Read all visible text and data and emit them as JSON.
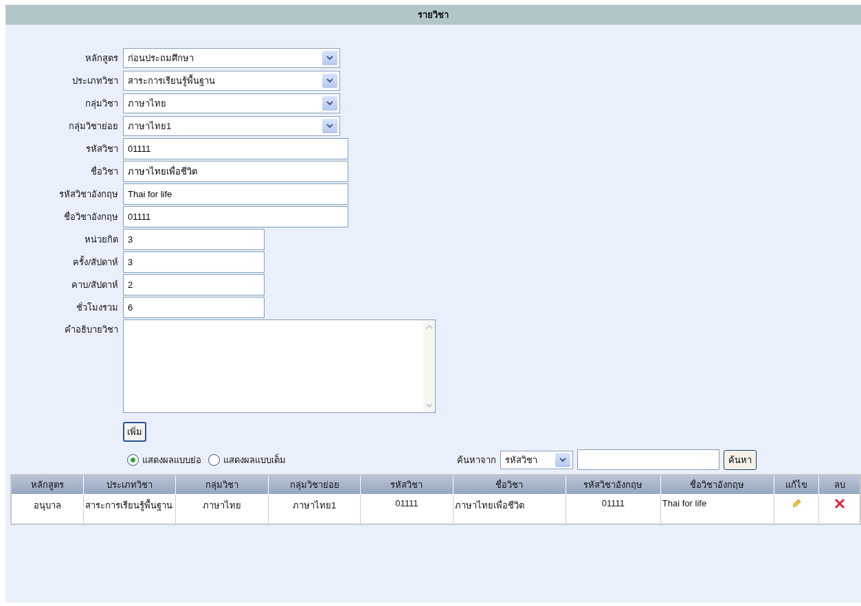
{
  "header": {
    "title": "รายวิชา"
  },
  "form": {
    "fields": [
      {
        "kind": "select",
        "label": "หลักสูตร",
        "value": "ก่อนประถมศึกษา"
      },
      {
        "kind": "select",
        "label": "ประเภทวิชา",
        "value": "สาระการเรียนรู้พื้นฐาน"
      },
      {
        "kind": "select",
        "label": "กลุ่มวิชา",
        "value": "ภาษาไทย"
      },
      {
        "kind": "select",
        "label": "กลุ่มวิชาย่อย",
        "value": "ภาษาไทย1"
      },
      {
        "kind": "text",
        "label": "รหัสวิชา",
        "value": "01111"
      },
      {
        "kind": "text",
        "label": "ชื่อวิชา",
        "value": "ภาษาไทยเพื่อชีวิต"
      },
      {
        "kind": "text",
        "label": "รหัสวิชาอังกฤษ",
        "value": "Thai for life"
      },
      {
        "kind": "text",
        "label": "ชื่อวิชาอังกฤษ",
        "value": "01111"
      },
      {
        "kind": "short",
        "label": "หน่วยกิต",
        "value": "3"
      },
      {
        "kind": "short",
        "label": "ครั้ง/สัปดาห์",
        "value": "3"
      },
      {
        "kind": "short",
        "label": "คาบ/สัปดาห์",
        "value": "2"
      },
      {
        "kind": "short",
        "label": "ชั่วโมงรวม",
        "value": "6"
      },
      {
        "kind": "textarea",
        "label": "คำอธิบายวิชา"
      }
    ],
    "add_button": "เพิ่ม"
  },
  "display_modes": [
    {
      "label": "แสดงผลแบบย่อ",
      "selected": true
    },
    {
      "label": "แสดงผลแบบเต็ม",
      "selected": false
    }
  ],
  "search": {
    "label": "ค้นหาจาก",
    "field": "รหัสวิชา",
    "button": "ค้นหา"
  },
  "table": {
    "columns": [
      "หลักสูตร",
      "ประเภทวิชา",
      "กลุ่มวิชา",
      "กลุ่มวิชาย่อย",
      "รหัสวิชา",
      "ชื่อวิชา",
      "รหัสวิชาอังกฤษ",
      "ชื่อวิชาอังกฤษ",
      "แก้ไข",
      "ลบ"
    ],
    "rows": [
      {
        "cells": [
          "อนุบาล",
          "สาระการเรียนรู้พื้นฐาน",
          "ภาษาไทย",
          "ภาษาไทย1",
          "01111",
          "ภาษาไทยเพื่อชีวิต",
          "01111",
          "Thai for life"
        ]
      }
    ]
  }
}
